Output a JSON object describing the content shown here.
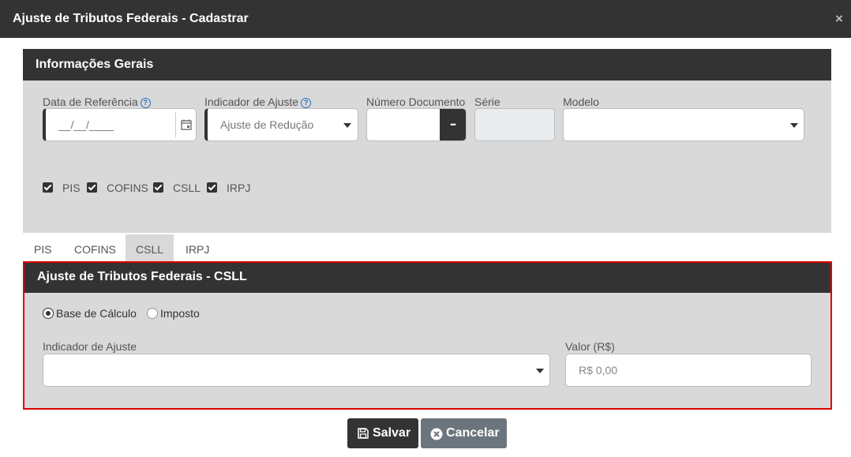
{
  "dialog": {
    "title": "Ajuste de Tributos Federais - Cadastrar",
    "close_glyph": "×"
  },
  "general": {
    "header": "Informações Gerais",
    "data_referencia": {
      "label": "Data de Referência",
      "value": "__/__/____"
    },
    "indicador_ajuste": {
      "label": "Indicador de Ajuste",
      "value": "Ajuste de Redução"
    },
    "numero_documento": {
      "label": "Número Documento",
      "value": "",
      "button_glyph": "•••"
    },
    "serie": {
      "label": "Série",
      "value": ""
    },
    "modelo": {
      "label": "Modelo",
      "value": ""
    },
    "help_glyph": "?",
    "checkboxes": [
      {
        "label": "PIS",
        "checked": true
      },
      {
        "label": "COFINS",
        "checked": true
      },
      {
        "label": "CSLL",
        "checked": true
      },
      {
        "label": "IRPJ",
        "checked": true
      }
    ]
  },
  "tabs": [
    {
      "label": "PIS",
      "active": false
    },
    {
      "label": "COFINS",
      "active": false
    },
    {
      "label": "CSLL",
      "active": true
    },
    {
      "label": "IRPJ",
      "active": false
    }
  ],
  "csll": {
    "header": "Ajuste de Tributos Federais - CSLL",
    "radios": [
      {
        "label": "Base de Cálculo",
        "selected": true
      },
      {
        "label": "Imposto",
        "selected": false
      }
    ],
    "indicador_ajuste": {
      "label": "Indicador de Ajuste",
      "value": ""
    },
    "valor": {
      "label": "Valor (R$)",
      "placeholder": "R$ 0,00"
    }
  },
  "actions": {
    "save_label": "Salvar",
    "cancel_label": "Cancelar"
  },
  "colors": {
    "header_dark": "#333333",
    "panel_bg": "#d9d9d9",
    "highlight_border": "#e00000",
    "cancel_bg": "#6c757d"
  }
}
